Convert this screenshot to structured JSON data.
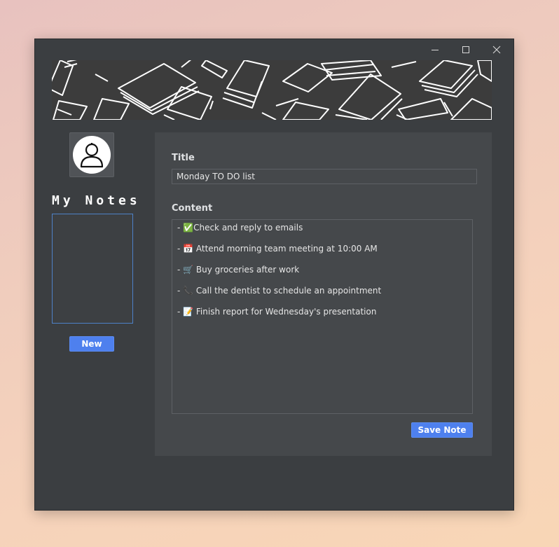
{
  "window": {
    "controls": {
      "minimize": "minimize-icon",
      "maximize": "maximize-icon",
      "close": "close-icon"
    },
    "banner": "books-pattern-banner"
  },
  "sidebar": {
    "avatar_icon": "user-icon",
    "heading": "My Notes",
    "new_button": "New"
  },
  "editor": {
    "title_label": "Title",
    "title_value": "Monday TO DO list",
    "content_label": "Content",
    "content_lines": [
      "- ✅Check and reply to emails",
      "- 📅 Attend morning team meeting at 10:00 AM",
      "- 🛒 Buy groceries after work",
      "- 📞 Call the dentist to schedule an appointment",
      "- 📝 Finish report for Wednesday's presentation"
    ],
    "save_button": "Save Note"
  },
  "colors": {
    "window_bg": "#3b3e41",
    "panel_bg": "#45484b",
    "accent_blue": "#4e80ee",
    "list_border": "#4e82c8"
  }
}
